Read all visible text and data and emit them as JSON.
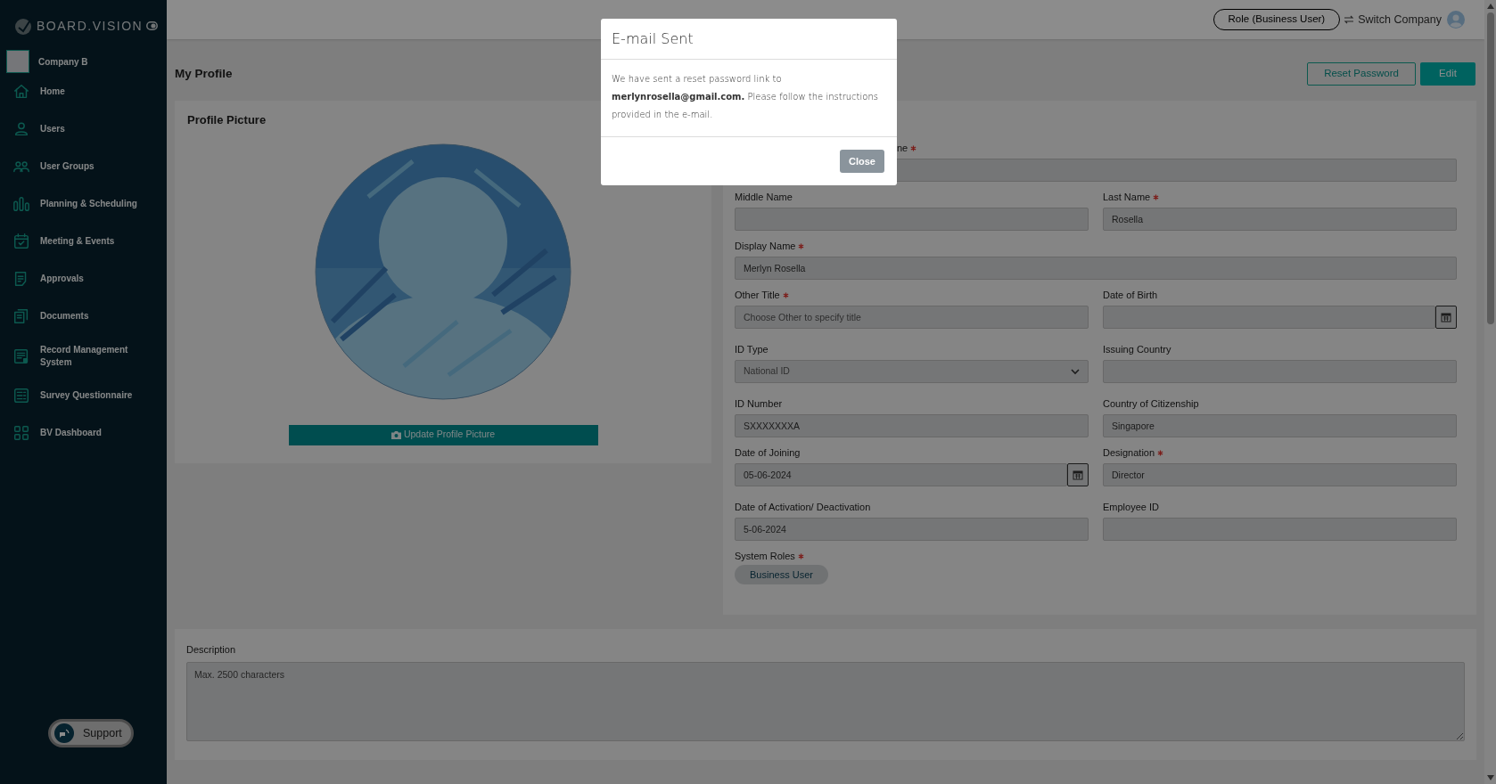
{
  "sidebar": {
    "brand": "BOARD.VISION",
    "company": "Company B",
    "items": [
      {
        "label": "Home"
      },
      {
        "label": "Users"
      },
      {
        "label": "User Groups"
      },
      {
        "label": "Planning & Scheduling"
      },
      {
        "label": "Meeting & Events"
      },
      {
        "label": "Approvals"
      },
      {
        "label": "Documents"
      },
      {
        "label": "Record Management System"
      },
      {
        "label": "Survey Questionnaire"
      },
      {
        "label": "BV Dashboard"
      }
    ],
    "support": "Support"
  },
  "topbar": {
    "role": "Role (Business User)",
    "switch_company": "Switch Company"
  },
  "page": {
    "title": "My Profile",
    "buttons": [
      "Reset Password",
      "Edit"
    ]
  },
  "profile_picture": {
    "title": "Profile Picture",
    "button": "Update Profile Picture"
  },
  "form": {
    "rows": [
      [
        {
          "label": "ne",
          "required": true,
          "kind": "text"
        }
      ],
      [
        {
          "label": "Middle Name",
          "required": false,
          "kind": "text"
        },
        {
          "label": "Last Name",
          "required": true,
          "kind": "text",
          "value": "Rosella"
        }
      ],
      [
        {
          "label": "Display Name",
          "required": true,
          "kind": "text",
          "value": "Merlyn Rosella"
        }
      ],
      [
        {
          "label": "Other Title",
          "required": true,
          "kind": "text",
          "placeholder": "Choose Other to specify title"
        },
        {
          "label": "Date of Birth",
          "required": false,
          "kind": "date"
        }
      ],
      [
        {
          "label": "ID Type",
          "required": false,
          "kind": "select",
          "value": "National ID"
        },
        {
          "label": "Issuing Country",
          "required": false,
          "kind": "text"
        }
      ],
      [
        {
          "label": "ID Number",
          "required": false,
          "kind": "text",
          "value": "SXXXXXXXA"
        },
        {
          "label": "Country of Citizenship",
          "required": false,
          "kind": "text",
          "value": "Singapore"
        }
      ],
      [
        {
          "label": "Date of Joining",
          "required": false,
          "kind": "date",
          "value": "05-06-2024"
        },
        {
          "label": "Designation",
          "required": true,
          "kind": "text",
          "value": "Director"
        }
      ],
      [
        {
          "label": "Date of Activation/ Deactivation",
          "required": false,
          "kind": "text",
          "value": "5-06-2024"
        },
        {
          "label": "Employee ID",
          "required": false,
          "kind": "text"
        }
      ]
    ],
    "system_roles": {
      "label": "System Roles",
      "required": true,
      "tags": [
        "Business User"
      ]
    }
  },
  "description": {
    "label": "Description",
    "placeholder": "Max. 2500 characters"
  },
  "modal": {
    "title": "E-mail Sent",
    "message": "We have sent a reset password link to **merlynrosella@gmail.com.** Please follow the instructions provided in the e-mail.",
    "button": "Close"
  }
}
